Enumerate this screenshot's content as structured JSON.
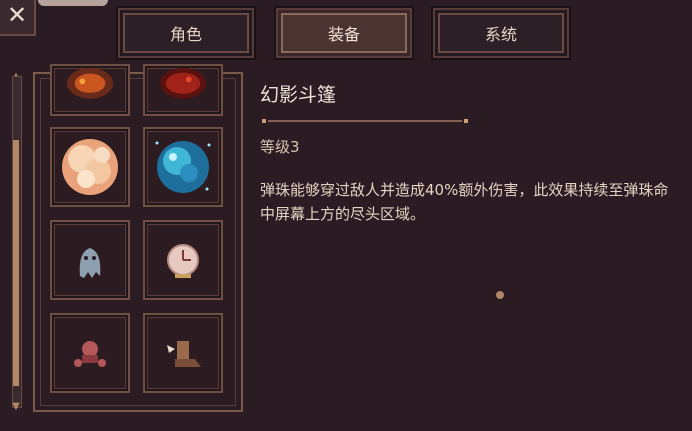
{
  "tabs": [
    {
      "label": "角色",
      "active": false
    },
    {
      "label": "装备",
      "active": true
    },
    {
      "label": "系统",
      "active": false
    }
  ],
  "close_icon": "close-icon",
  "item": {
    "name": "幻影斗篷",
    "level": "等级3",
    "description": "弹珠能够穿过敌人并造成40%额外伤害，此效果持续至弹珠命中屏幕上方的尽头区域。"
  },
  "grid_items": [
    {
      "name": "ember-orb-icon",
      "partial": true
    },
    {
      "name": "lava-orb-icon",
      "partial": true
    },
    {
      "name": "cloud-orb-icon"
    },
    {
      "name": "crystal-orb-icon"
    },
    {
      "name": "ghost-icon"
    },
    {
      "name": "clock-orb-icon"
    },
    {
      "name": "red-creature-icon"
    },
    {
      "name": "boot-icon"
    }
  ],
  "colors": {
    "background": "#2a1c22",
    "frame": "#7a5a48",
    "text": "#e6d3c4",
    "active_tab": "#4a3432"
  }
}
